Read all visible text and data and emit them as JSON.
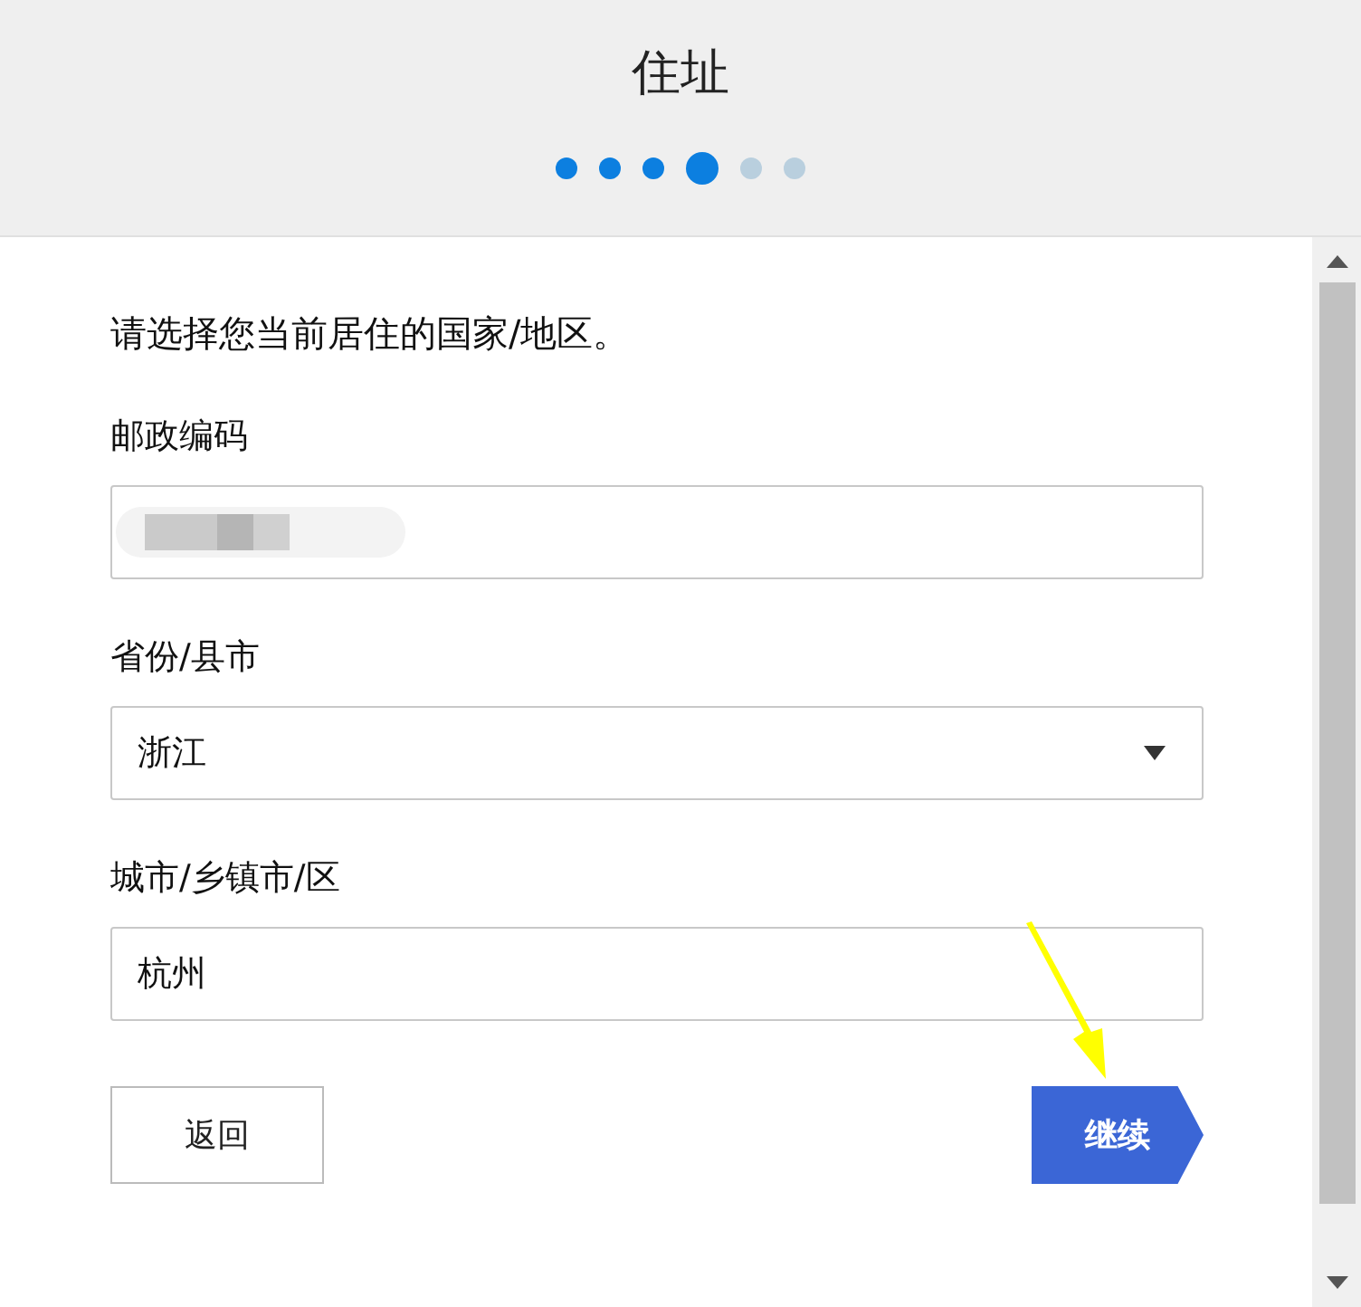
{
  "header": {
    "title": "住址",
    "steps": [
      {
        "kind": "done"
      },
      {
        "kind": "done"
      },
      {
        "kind": "done"
      },
      {
        "kind": "current"
      },
      {
        "kind": "todo"
      },
      {
        "kind": "todo"
      }
    ]
  },
  "prompt": "请选择您当前居住的国家/地区。",
  "fields": [
    {
      "kind": "text",
      "label": "邮政编码",
      "redacted": true
    },
    {
      "kind": "select",
      "label": "省份/县市",
      "value": "浙江"
    },
    {
      "kind": "text",
      "label": "城市/乡镇市/区",
      "value": "杭州"
    }
  ],
  "buttons": [
    {
      "kind": "back",
      "label": "返回"
    },
    {
      "kind": "next",
      "label": "继续"
    }
  ],
  "annotation": {
    "kind": "arrow"
  }
}
